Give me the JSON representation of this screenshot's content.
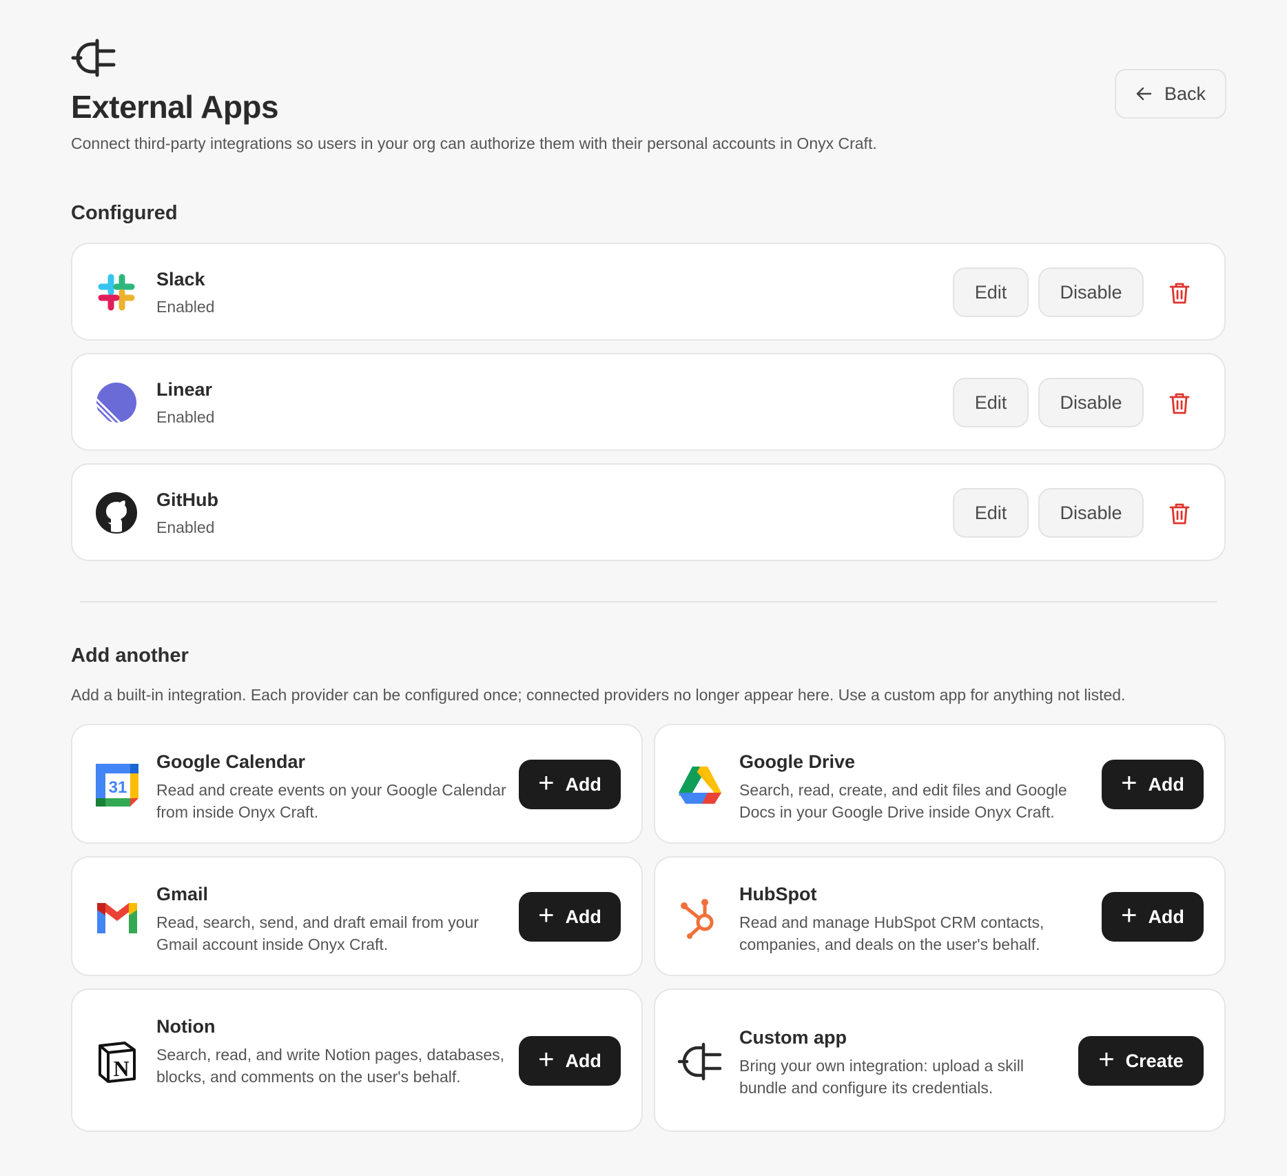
{
  "header": {
    "title": "External Apps",
    "subtitle": "Connect third-party integrations so users in your org can authorize them with their personal accounts in Onyx Craft.",
    "back_label": "Back"
  },
  "configured": {
    "title": "Configured",
    "items": [
      {
        "name": "Slack",
        "status": "Enabled",
        "icon": "slack-icon",
        "edit_label": "Edit",
        "disable_label": "Disable"
      },
      {
        "name": "Linear",
        "status": "Enabled",
        "icon": "linear-icon",
        "edit_label": "Edit",
        "disable_label": "Disable"
      },
      {
        "name": "GitHub",
        "status": "Enabled",
        "icon": "github-icon",
        "edit_label": "Edit",
        "disable_label": "Disable"
      }
    ]
  },
  "add_another": {
    "title": "Add another",
    "description": "Add a built-in integration. Each provider can be configured once; connected providers no longer appear here. Use a custom app for anything not listed.",
    "items": [
      {
        "name": "Google Calendar",
        "description": "Read and create events on your Google Calendar from inside Onyx Craft.",
        "icon": "google-calendar-icon",
        "icon_text": "31",
        "button_label": "Add"
      },
      {
        "name": "Google Drive",
        "description": "Search, read, create, and edit files and Google Docs in your Google Drive inside Onyx Craft.",
        "icon": "google-drive-icon",
        "button_label": "Add"
      },
      {
        "name": "Gmail",
        "description": "Read, search, send, and draft email from your Gmail account inside Onyx Craft.",
        "icon": "gmail-icon",
        "button_label": "Add"
      },
      {
        "name": "HubSpot",
        "description": "Read and manage HubSpot CRM contacts, companies, and deals on the user's behalf.",
        "icon": "hubspot-icon",
        "button_label": "Add"
      },
      {
        "name": "Notion",
        "description": "Search, read, and write Notion pages, databases, blocks, and comments on the user's behalf.",
        "icon": "notion-icon",
        "icon_text": "N",
        "button_label": "Add"
      },
      {
        "name": "Custom app",
        "description": "Bring your own integration: upload a skill bundle and configure its credentials.",
        "icon": "plug-icon",
        "button_label": "Create"
      }
    ]
  },
  "colors": {
    "background": "#f7f7f7",
    "card": "#ffffff",
    "primary_button": "#1c1c1c",
    "danger": "#e0332c"
  }
}
